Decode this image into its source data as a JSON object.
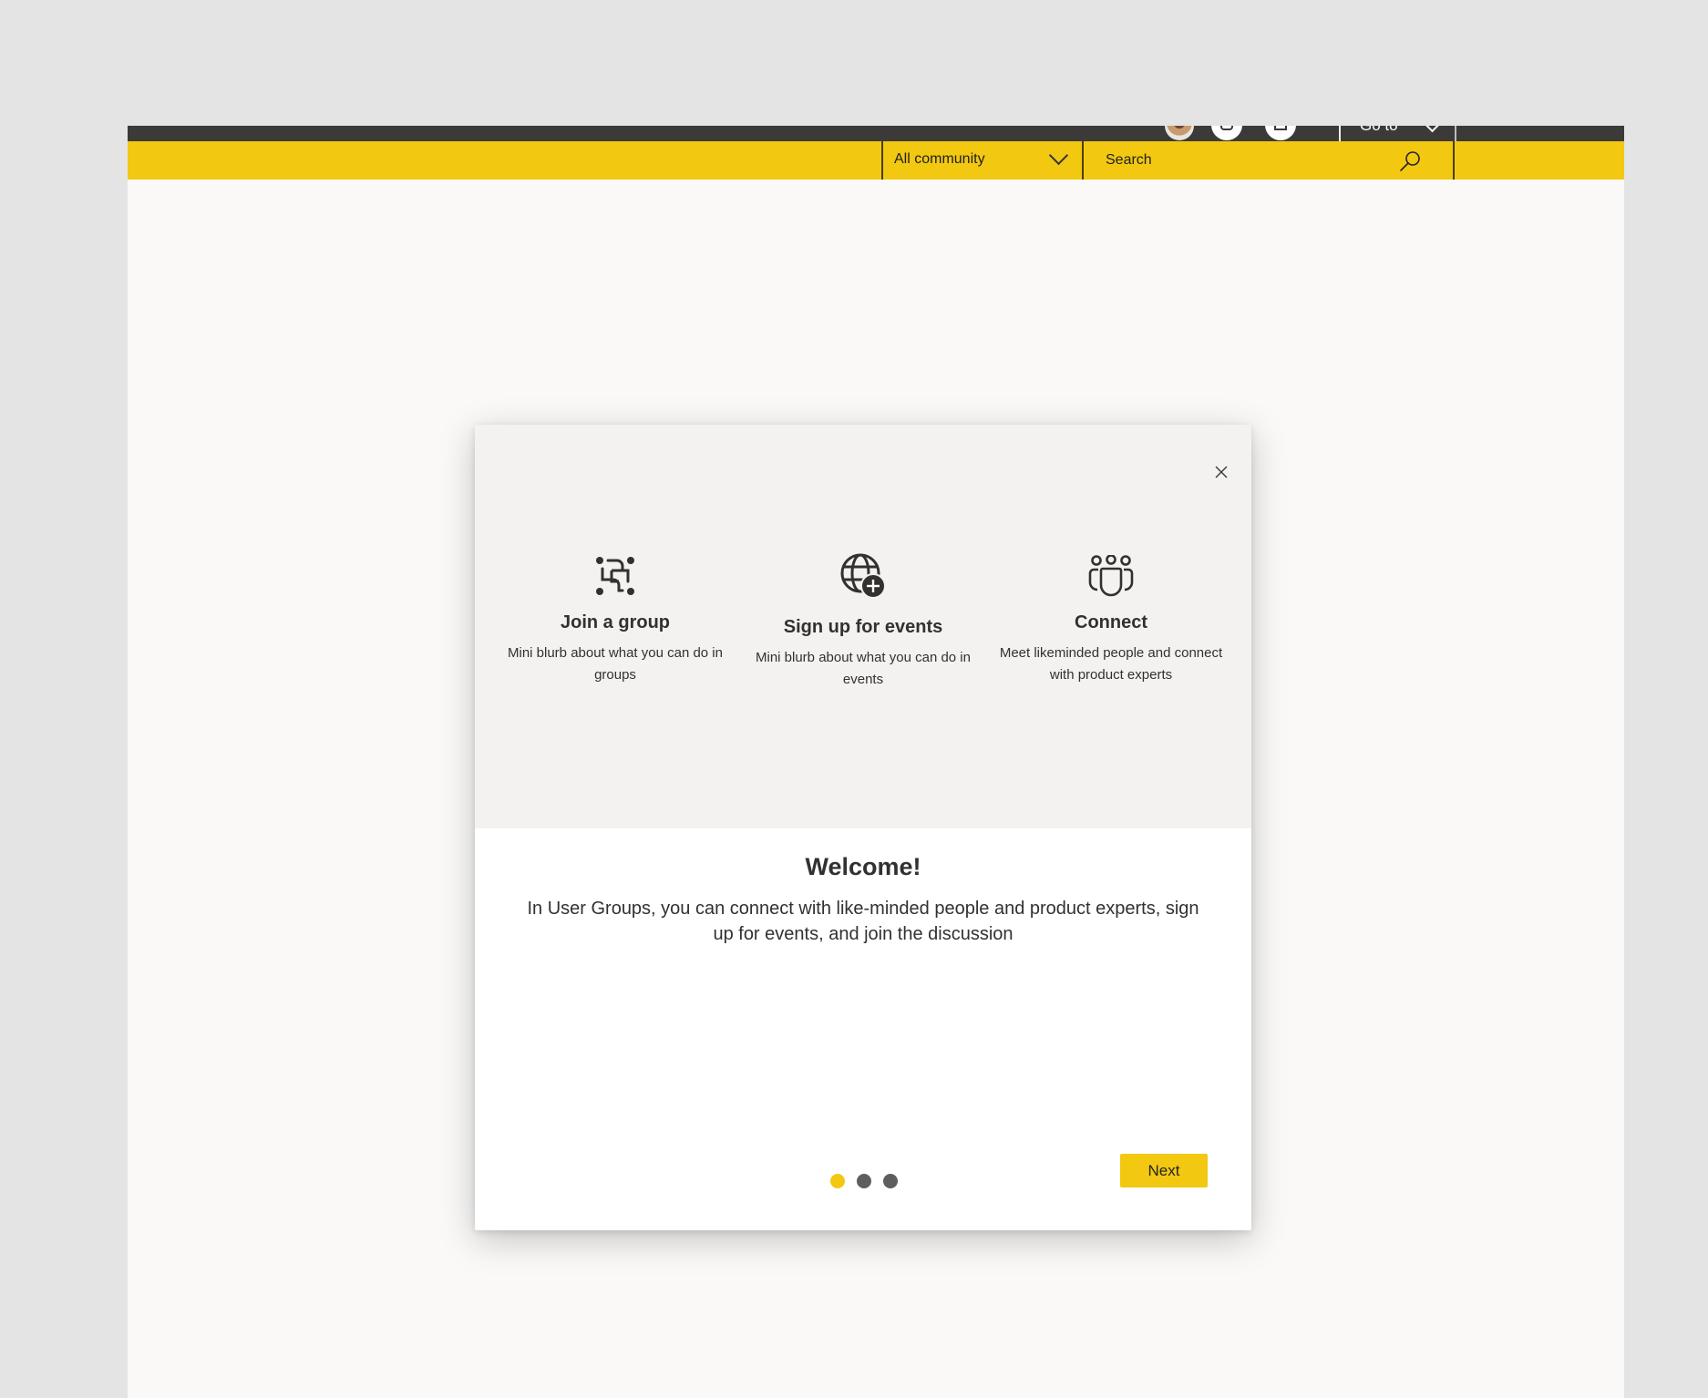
{
  "header": {
    "goto_label": "Go to",
    "scope_dropdown": {
      "selected": "All community"
    },
    "search": {
      "placeholder": "Search"
    },
    "icons": [
      "avatar",
      "notifications-bell-icon",
      "mail-icon",
      "chevron-down-icon",
      "search-icon"
    ]
  },
  "colors": {
    "brand_yellow": "#f2c811",
    "topbar_dark": "#3b3a39",
    "dot_inactive": "#605e5c",
    "text": "#323130"
  },
  "modal": {
    "close_label": "Close",
    "features": [
      {
        "icon": "group-icon",
        "title": "Join a group",
        "description": "Mini blurb about what you can do in groups"
      },
      {
        "icon": "globe-add-icon",
        "title": "Sign up for events",
        "description": "Mini blurb about what you can do in events"
      },
      {
        "icon": "people-community-icon",
        "title": "Connect",
        "description": "Meet likeminded people and connect with product experts"
      }
    ],
    "title": "Welcome!",
    "body": "In User Groups, you can connect with like-minded people and product experts, sign up for events, and join the discussion",
    "pagination": {
      "current": 1,
      "total": 3
    },
    "next_label": "Next"
  }
}
